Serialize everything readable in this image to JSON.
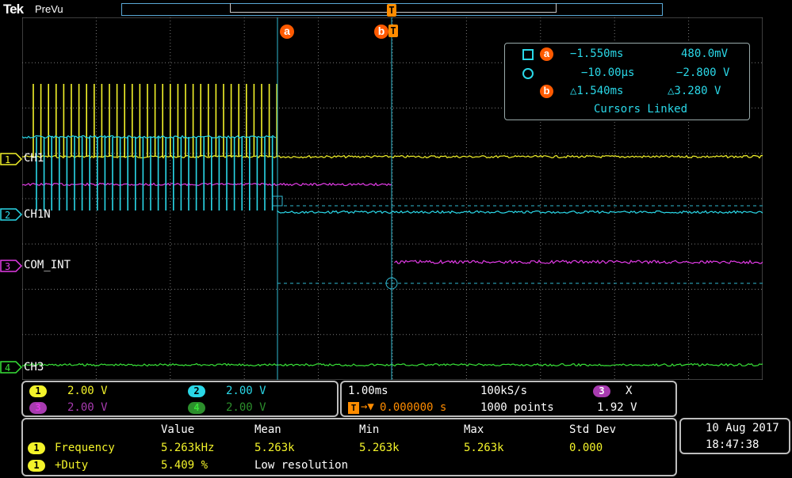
{
  "header": {
    "brand": "Tek",
    "mode": "PreVu",
    "trigger_marker": "T"
  },
  "colors": {
    "ch1": "#f3f32a",
    "ch2": "#2ad8e8",
    "ch3": "#e23be6",
    "ch4": "#38e238",
    "cursor": "#2fb8d0",
    "cursor_badge": "#ff5a00",
    "grid": "#7a7a7a"
  },
  "channels": {
    "ch1": {
      "number": "1",
      "label": "CH1"
    },
    "ch2": {
      "number": "2",
      "label": "CH1N"
    },
    "ch3": {
      "number": "3",
      "label": "COM_INT"
    },
    "ch4": {
      "number": "4",
      "label": "CH3"
    }
  },
  "cursors": {
    "a_badge": "a",
    "b_badge": "b",
    "a_time": "−1.550ms",
    "a_volt": "480.0mV",
    "o_time": "−10.00μs",
    "o_volt": "−2.800 V",
    "delta_time": "△1.540ms",
    "delta_volt": "△3.280 V",
    "linked": "Cursors Linked"
  },
  "scales": {
    "ch1": {
      "num": "1",
      "value": "2.00 V"
    },
    "ch2": {
      "num": "2",
      "value": "2.00 V"
    },
    "ch3": {
      "num": "3",
      "value": "2.00 V"
    },
    "ch4": {
      "num": "4",
      "value": "2.00 V"
    }
  },
  "timebase": {
    "horizontal": "1.00ms",
    "sample_rate": "100kS/s",
    "trigger_ch": "3",
    "trigger_slope": "X",
    "trigger_pos": "0.000000 s",
    "points": "1000 points",
    "trigger_level": "1.92 V"
  },
  "measurements": {
    "headers": [
      "Value",
      "Mean",
      "Min",
      "Max",
      "Std Dev"
    ],
    "rows": [
      {
        "ch": "1",
        "name": "Frequency",
        "value": "5.263kHz",
        "mean": "5.263k",
        "min": "5.263k",
        "max": "5.263k",
        "std": "0.000"
      },
      {
        "ch": "1",
        "name": "+Duty",
        "value": "5.409 %",
        "mean": "Low resolution",
        "min": "",
        "max": "",
        "std": ""
      }
    ]
  },
  "datetime": {
    "date": "10 Aug 2017",
    "time": "18:47:38"
  }
}
